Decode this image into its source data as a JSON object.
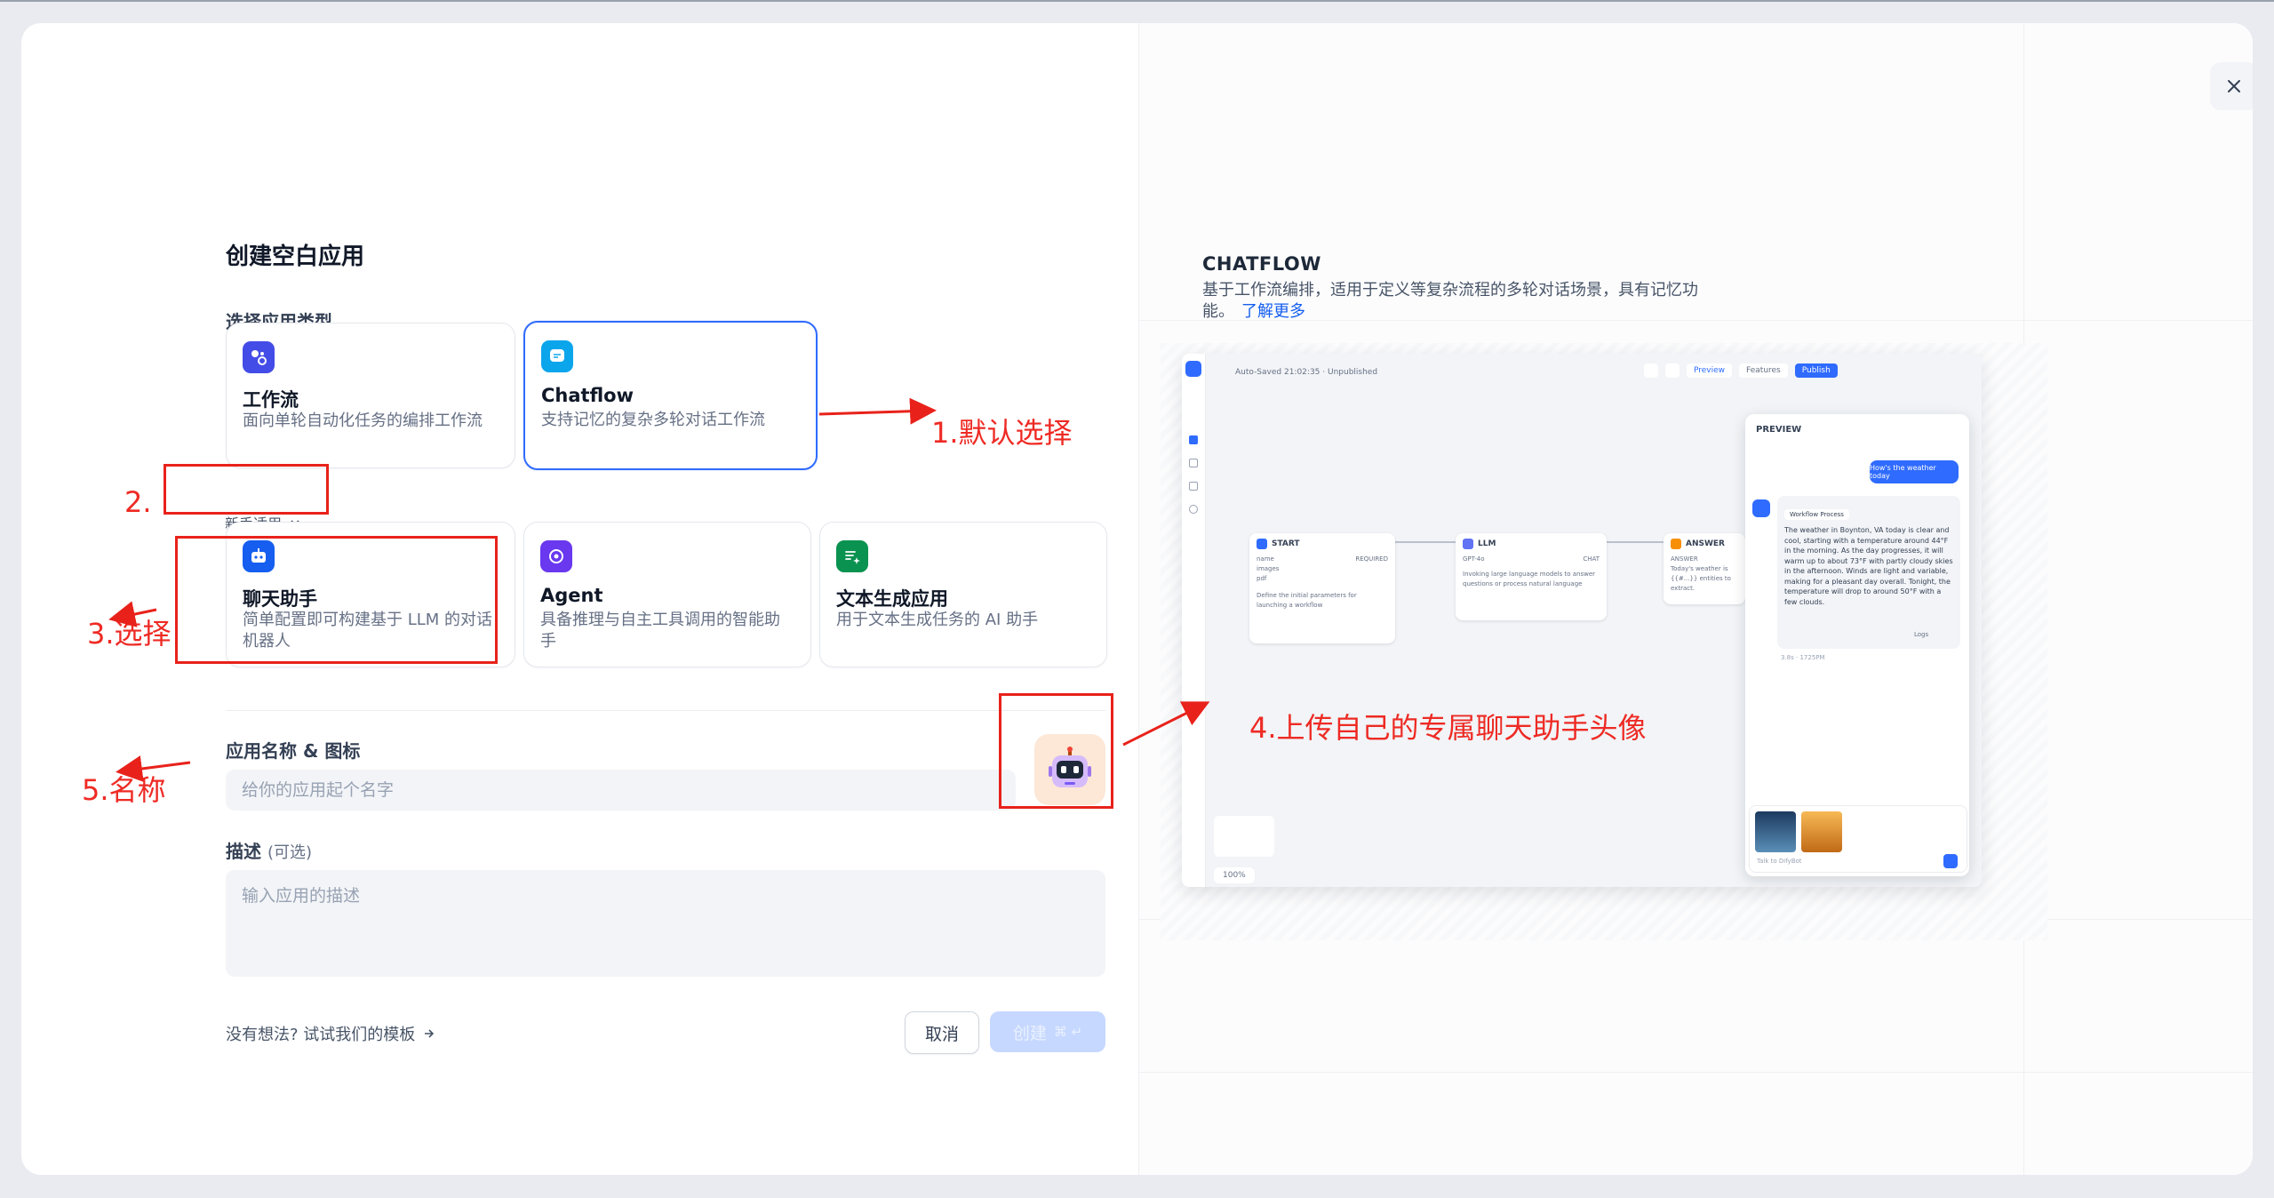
{
  "modal": {
    "title": "创建空白应用",
    "section_type": "选择应用类型",
    "cards_top": [
      {
        "title": "工作流",
        "desc": "面向单轮自动化任务的编排工作流",
        "icon": "workflow-icon",
        "color": "#444ce7"
      },
      {
        "title": "Chatflow",
        "desc": "支持记忆的复杂多轮对话工作流",
        "icon": "chatflow-icon",
        "color": "#0ba5ec"
      }
    ],
    "beginner_label": "新手适用",
    "cards_bottom": [
      {
        "title": "聊天助手",
        "desc": "简单配置即可构建基于 LLM 的对话机器人",
        "icon": "chat-assistant-icon",
        "color": "#155eef"
      },
      {
        "title": "Agent",
        "desc": "具备推理与自主工具调用的智能助手",
        "icon": "agent-icon",
        "color": "#6938ef"
      },
      {
        "title": "文本生成应用",
        "desc": "用于文本生成任务的 AI 助手",
        "icon": "text-generation-icon",
        "color": "#099250"
      }
    ],
    "name_label": "应用名称 & 图标",
    "name_placeholder": "给你的应用起个名字",
    "desc_label": "描述",
    "desc_optional": "(可选)",
    "desc_placeholder": "输入应用的描述",
    "template_link": "没有想法? 试试我们的模板",
    "cancel": "取消",
    "create": "创建",
    "create_shortcut": "⌘ ↵"
  },
  "right": {
    "title": "CHATFLOW",
    "desc": "基于工作流编排，适用于定义等复杂流程的多轮对话场景，具有记忆功能。",
    "learn_more": "了解更多"
  },
  "preview_shot": {
    "autosave": "Auto-Saved 21:02:35 · Unpublished",
    "preview_btn": "Preview",
    "features_btn": "Features",
    "publish_btn": "Publish",
    "panel_title": "PREVIEW",
    "user_msg": "How's the weather today",
    "workflow_process": "Workflow Process",
    "answer": "The weather in Boynton, VA today is clear and cool, starting with a temperature around 44°F in the morning. As the day progresses, it will warm up to about 73°F with partly cloudy skies in the afternoon. Winds are light and variable, making for a pleasant day overall. Tonight, the temperature will drop to around 50°F with a few clouds.",
    "answer_meta": "3.8s · 1725PM",
    "chat_placeholder": "Talk to DifyBot",
    "start_node": "START",
    "start_fields": [
      "name",
      "images",
      "pdf"
    ],
    "start_required": "REQUIRED",
    "start_desc": "Define the initial parameters for launching a workflow",
    "llm_node": "LLM",
    "llm_model": "GPT-4o",
    "llm_mode": "CHAT",
    "llm_desc": "Invoking large language models to answer questions or process natural language",
    "answer_node": "ANSWER",
    "answer_node_label": "ANSWER",
    "answer_node_text": "Today's weather is {{#...}} entities to extract.",
    "zoom": "100%",
    "logs": "Logs"
  },
  "annotations": {
    "a1": "1.默认选择",
    "a2": "2.",
    "a3": "3.选择",
    "a4": "4.上传自己的专属聊天助手头像",
    "a5": "5.名称",
    "color": "#e8221b"
  }
}
